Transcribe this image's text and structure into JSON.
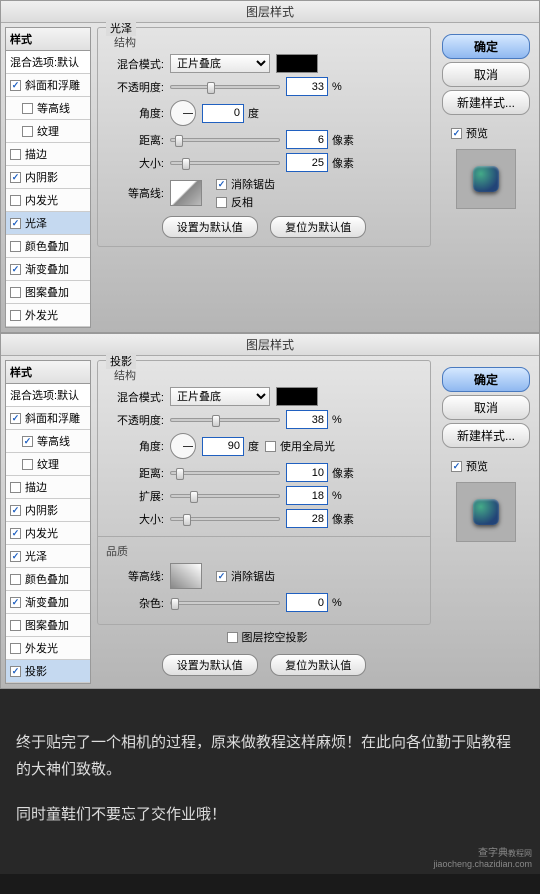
{
  "dialog_title": "图层样式",
  "sidebar": {
    "header": "样式",
    "blend_options": "混合选项:默认",
    "items": [
      {
        "label": "斜面和浮雕",
        "checked": true
      },
      {
        "label": "等高线",
        "checked": false,
        "indent": true
      },
      {
        "label": "纹理",
        "checked": false,
        "indent": true
      },
      {
        "label": "描边",
        "checked": false
      },
      {
        "label": "内阴影",
        "checked": true
      },
      {
        "label": "内发光",
        "checked": false
      },
      {
        "label": "光泽",
        "checked": true
      },
      {
        "label": "颜色叠加",
        "checked": false
      },
      {
        "label": "渐变叠加",
        "checked": true
      },
      {
        "label": "图案叠加",
        "checked": false
      },
      {
        "label": "外发光",
        "checked": false
      }
    ]
  },
  "sidebar2": {
    "items": [
      {
        "label": "斜面和浮雕",
        "checked": true
      },
      {
        "label": "等高线",
        "checked": true,
        "indent": true
      },
      {
        "label": "纹理",
        "checked": false,
        "indent": true
      },
      {
        "label": "描边",
        "checked": false
      },
      {
        "label": "内阴影",
        "checked": true
      },
      {
        "label": "内发光",
        "checked": true
      },
      {
        "label": "光泽",
        "checked": true
      },
      {
        "label": "颜色叠加",
        "checked": false
      },
      {
        "label": "渐变叠加",
        "checked": true
      },
      {
        "label": "图案叠加",
        "checked": false
      },
      {
        "label": "外发光",
        "checked": false
      },
      {
        "label": "投影",
        "checked": true
      }
    ]
  },
  "panel1": {
    "title": "光泽",
    "structure": "结构",
    "blend_label": "混合模式:",
    "blend_value": "正片叠底",
    "opacity_label": "不透明度:",
    "opacity_value": "33",
    "percent": "%",
    "angle_label": "角度:",
    "angle_value": "0",
    "degree": "度",
    "distance_label": "距离:",
    "distance_value": "6",
    "px": "像素",
    "size_label": "大小:",
    "size_value": "25",
    "contour_label": "等高线:",
    "antialias": "消除锯齿",
    "invert": "反相",
    "reset_default": "设置为默认值",
    "restore_default": "复位为默认值",
    "selected_idx": 6
  },
  "panel2": {
    "title": "投影",
    "structure": "结构",
    "blend_label": "混合模式:",
    "blend_value": "正片叠底",
    "opacity_label": "不透明度:",
    "opacity_value": "38",
    "percent": "%",
    "angle_label": "角度:",
    "angle_value": "90",
    "degree": "度",
    "global_light": "使用全局光",
    "distance_label": "距离:",
    "distance_value": "10",
    "px": "像素",
    "spread_label": "扩展:",
    "spread_value": "18",
    "size_label": "大小:",
    "size_value": "28",
    "quality": "品质",
    "contour_label": "等高线:",
    "antialias": "消除锯齿",
    "noise_label": "杂色:",
    "noise_value": "0",
    "knockout": "图层挖空投影",
    "reset_default": "设置为默认值",
    "restore_default": "复位为默认值",
    "selected_idx": 11
  },
  "actions": {
    "ok": "确定",
    "cancel": "取消",
    "new_style": "新建样式...",
    "preview": "预览"
  },
  "caption": {
    "line1": "终于贴完了一个相机的过程，原来做教程这样麻烦！在此向各位勤于贴教程的大神们致敬。",
    "line2": "同时童鞋们不要忘了交作业哦！"
  },
  "watermark": {
    "site": "查字典",
    "sub": "教程网",
    "url": "jiaocheng.chazidian.com"
  }
}
